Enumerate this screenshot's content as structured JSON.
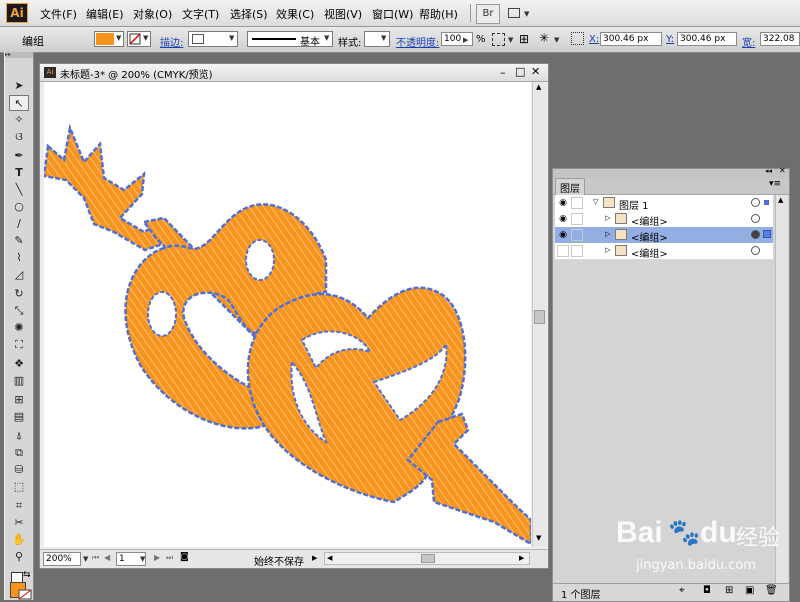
{
  "app": {
    "logo": "Ai",
    "brand_color": "#f2a03a"
  },
  "menus": [
    "文件(F)",
    "编辑(E)",
    "对象(O)",
    "文字(T)",
    "选择(S)",
    "效果(C)",
    "视图(V)",
    "窗口(W)",
    "帮助(H)"
  ],
  "toolbar": {
    "bridge_label": "Br"
  },
  "control": {
    "selection_label": "编组",
    "fill_color": "#f7941d",
    "stroke_label": "描边:",
    "stroke_style": "基本",
    "style_label": "样式:",
    "opacity_label": "不透明度:",
    "opacity_value": "100",
    "opacity_unit": "%",
    "x_label": "X:",
    "x_value": "300.46 px",
    "y_label": "Y:",
    "y_value": "300.46 px",
    "width_label": "宽:",
    "width_value": "322.08"
  },
  "document": {
    "title": "未标题-3* @ 200% (CMYK/预览)",
    "zoom": "200%",
    "page": "1",
    "status": "始终不保存",
    "artwork_fill": "#f7941d",
    "artwork_stroke": "#4f6fd6"
  },
  "layers_panel": {
    "tab": "图层",
    "rows": [
      {
        "name": "图层 1",
        "selected": false
      },
      {
        "name": "<编组>",
        "selected": false
      },
      {
        "name": "<编组>",
        "selected": true
      },
      {
        "name": "<编组>",
        "selected": false
      }
    ],
    "footer_count": "1 个图层",
    "selection_color": "#92aee3"
  },
  "watermark": {
    "brand": "Bai",
    "brand2": "du",
    "suffix": "经验",
    "url": "jingyan.baidu.com"
  }
}
